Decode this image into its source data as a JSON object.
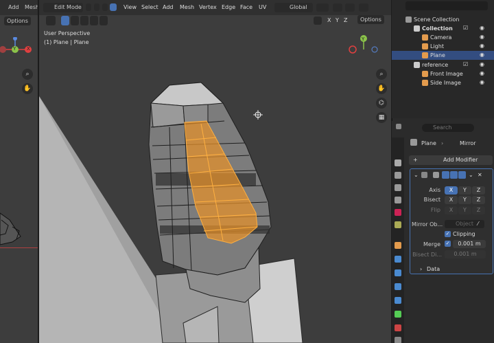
{
  "left_panel": {
    "menu": [
      "Add",
      "Mesh"
    ],
    "options_label": "Options",
    "gizmo_labels": {
      "y": "Y",
      "x": "X"
    }
  },
  "header": {
    "mode": "Edit Mode",
    "menus": [
      "View",
      "Select",
      "Add",
      "Mesh",
      "Vertex",
      "Edge",
      "Face",
      "UV"
    ],
    "transform_orientation": "Global",
    "axis_x": "X",
    "axis_y": "Y",
    "axis_z": "Z",
    "options_label": "Options"
  },
  "viewport": {
    "perspective": "User Perspective",
    "object_info": "(1) Plane | Plane",
    "gizmo_labels": {
      "y": "Y",
      "x": "X",
      "z": "Z"
    }
  },
  "outliner": {
    "scene_collection": "Scene Collection",
    "rows": [
      {
        "label": "Collection",
        "color": "#cccccc"
      },
      {
        "label": "Camera",
        "color": "#e39b4d"
      },
      {
        "label": "Light",
        "color": "#e39b4d"
      },
      {
        "label": "Plane",
        "color": "#e39b4d"
      },
      {
        "label": "reference",
        "color": "#cccccc"
      },
      {
        "label": "Front Image",
        "color": "#e39b4d"
      },
      {
        "label": "Side Image",
        "color": "#e39b4d"
      }
    ]
  },
  "properties": {
    "search_placeholder": "Search",
    "breadcrumb_object": "Plane",
    "breadcrumb_modifier": "Mirror",
    "add_modifier": "Add Modifier",
    "axis_label": "Axis",
    "bisect_label": "Bisect",
    "flip_label": "Flip",
    "x": "X",
    "y": "Y",
    "z": "Z",
    "mirror_object_label": "Mirror Ob...",
    "mirror_object_placeholder": "Object",
    "clipping_label": "Clipping",
    "merge_label": "Merge",
    "merge_value": "0.001 m",
    "bisect_distance_label": "Bisect Di...",
    "bisect_distance_value": "0.001 m",
    "data_label": "Data"
  },
  "colors": {
    "accent": "#4772b3",
    "selection": "#e8922a",
    "mesh": "#8a8a8a"
  }
}
